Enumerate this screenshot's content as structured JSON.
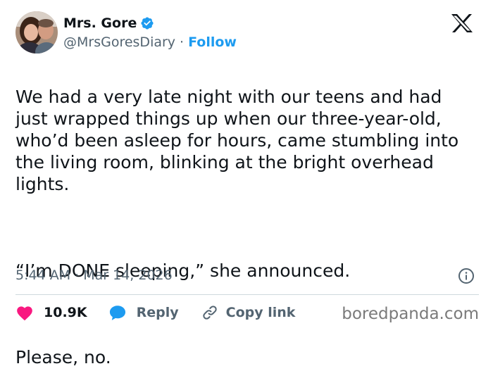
{
  "author": {
    "display_name": "Mrs. Gore",
    "handle": "@MrsGoresDiary",
    "separator": "·",
    "follow_label": "Follow",
    "verified_color": "#1d9bf0"
  },
  "tweet": {
    "paragraphs": [
      "We had a very late night with our teens and had just wrapped things up when our  three-year-old, who’d been asleep for hours, came stumbling into the living room, blinking at the bright overhead lights.",
      "“I’m DONE sleeping,” she announced.",
      "Please, no."
    ],
    "timestamp": "5:44 AM · Mar 14, 2026"
  },
  "actions": {
    "like_count": "10.9K",
    "reply_label": "Reply",
    "copy_link_label": "Copy link",
    "like_color": "#f91880",
    "reply_color": "#1d9bf0"
  },
  "icons": {
    "platform": "x-logo-icon",
    "info": "info-icon",
    "like": "heart-icon",
    "reply": "speech-bubble-icon",
    "copy": "link-icon"
  },
  "watermark": "boredpanda.com"
}
